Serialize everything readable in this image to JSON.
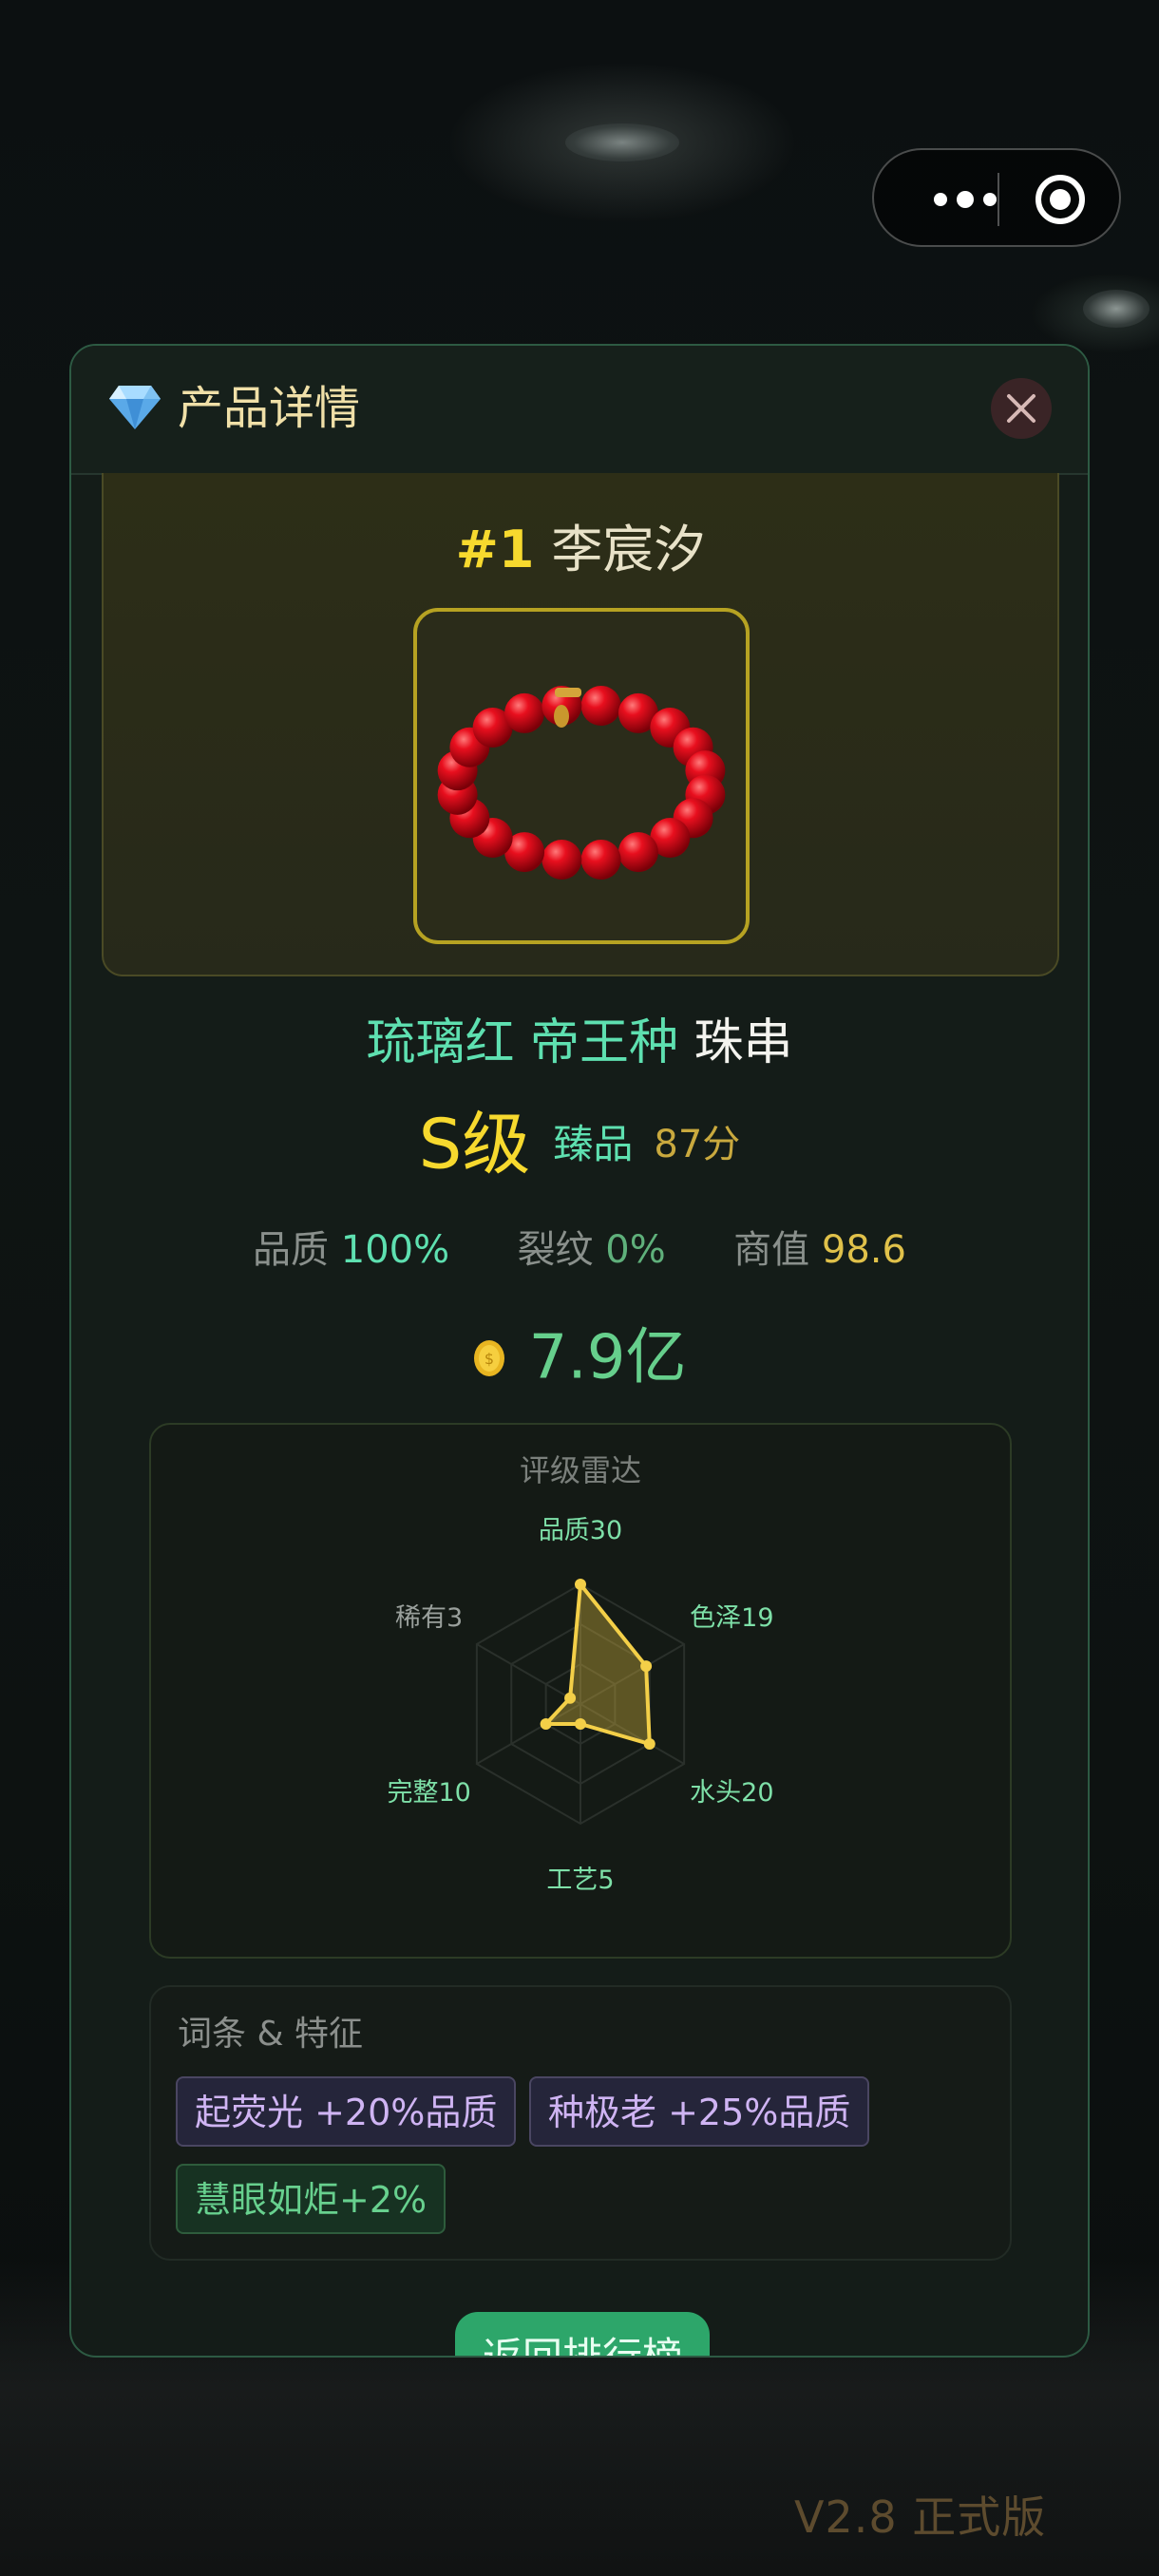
{
  "capsule": {
    "more_icon": "more-dots-icon",
    "close_icon": "target-circle-icon"
  },
  "modal": {
    "title": "产品详情",
    "title_icon": "gem-icon",
    "close_icon": "close-icon"
  },
  "hero": {
    "rank": "#1",
    "owner": "李宸汐"
  },
  "product": {
    "name_variety": "琉璃红 帝王种",
    "name_type": " 珠串",
    "grade": "S级",
    "tier": "臻品",
    "score": "87分"
  },
  "stats": {
    "quality_label": "品质",
    "quality_value": "100%",
    "crack_label": "裂纹",
    "crack_value": "0%",
    "value_label": "商值",
    "value_value": "98.6"
  },
  "price": {
    "value": "7.9亿",
    "icon": "coin-icon"
  },
  "radar": {
    "title": "评级雷达",
    "axes": [
      {
        "label": "品质30",
        "value": 30
      },
      {
        "label": "色泽19",
        "value": 19
      },
      {
        "label": "水头20",
        "value": 20
      },
      {
        "label": "工艺5",
        "value": 5
      },
      {
        "label": "完整10",
        "value": 10
      },
      {
        "label": "稀有3",
        "value": 3
      }
    ],
    "max": 30
  },
  "traits": {
    "title": "词条 & 特征",
    "items": [
      {
        "label": "起荧光 +20%品质",
        "style": "purple"
      },
      {
        "label": "种极老 +25%品质",
        "style": "purple"
      },
      {
        "label": "慧眼如炬+2%",
        "style": "green"
      }
    ]
  },
  "return_button": "返回排行榜",
  "version": "V2.8 正式版",
  "colors": {
    "accent_gold": "#f7d92e",
    "accent_green": "#5ee0b0",
    "button_green": "#2da66a"
  }
}
